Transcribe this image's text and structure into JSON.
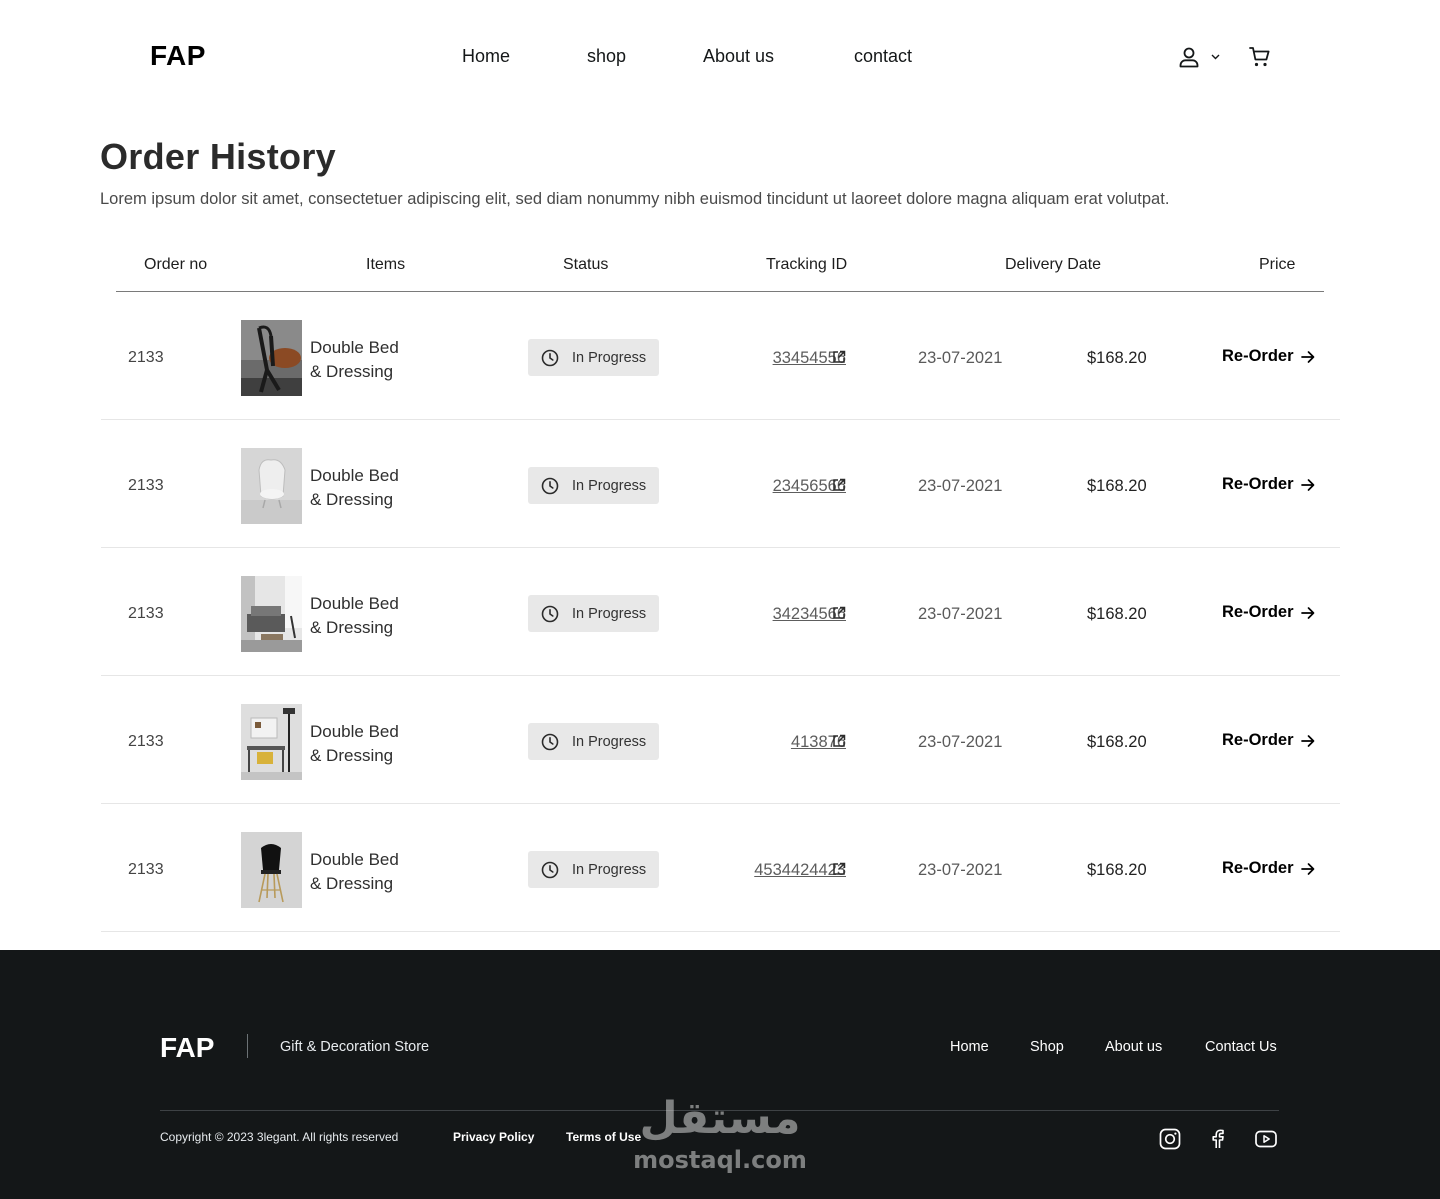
{
  "header": {
    "logo": "FAP",
    "nav": [
      "Home",
      "shop",
      "About us",
      "contact"
    ],
    "icons": [
      "user-icon",
      "chevron-down-icon",
      "cart-icon"
    ]
  },
  "page": {
    "title": "Order History",
    "intro": "Lorem ipsum dolor sit amet, consectetuer adipiscing elit, sed diam nonummy nibh euismod tincidunt ut laoreet dolore magna aliquam erat volutpat."
  },
  "table": {
    "columns": [
      "Order no",
      "Items",
      "Status",
      "Tracking ID",
      "Delivery Date",
      "Price"
    ],
    "rows": [
      {
        "order_no": "2133",
        "item_line1": "Double Bed",
        "item_line2": "& Dressing",
        "status": "In Progress",
        "tracking": "33454556",
        "date": "23-07-2021",
        "price": "$168.20",
        "action": "Re-Order"
      },
      {
        "order_no": "2133",
        "item_line1": "Double Bed",
        "item_line2": "& Dressing",
        "status": "In Progress",
        "tracking": "23456566",
        "date": "23-07-2021",
        "price": "$168.20",
        "action": "Re-Order"
      },
      {
        "order_no": "2133",
        "item_line1": "Double Bed",
        "item_line2": "& Dressing",
        "status": "In Progress",
        "tracking": "34234566",
        "date": "23-07-2021",
        "price": "$168.20",
        "action": "Re-Order"
      },
      {
        "order_no": "2133",
        "item_line1": "Double Bed",
        "item_line2": "& Dressing",
        "status": "In Progress",
        "tracking": "413876",
        "date": "23-07-2021",
        "price": "$168.20",
        "action": "Re-Order"
      },
      {
        "order_no": "2133",
        "item_line1": "Double Bed",
        "item_line2": "& Dressing",
        "status": "In Progress",
        "tracking": "4534424423",
        "date": "23-07-2021",
        "price": "$168.20",
        "action": "Re-Order"
      }
    ]
  },
  "footer": {
    "logo": "FAP",
    "tagline": "Gift & Decoration Store",
    "nav": [
      "Home",
      "Shop",
      "About us",
      "Contact Us"
    ],
    "copyright": "Copyright © 2023 3legant. All rights reserved",
    "privacy": "Privacy Policy",
    "terms": "Terms of Use",
    "social": [
      "instagram-icon",
      "facebook-icon",
      "youtube-icon"
    ]
  },
  "watermark": {
    "arabic": "مستقل",
    "latin": "mostaql.com"
  },
  "colors": {
    "footer_bg": "#141718",
    "status_bg": "#e8e8e8",
    "text_dark": "#141718"
  }
}
